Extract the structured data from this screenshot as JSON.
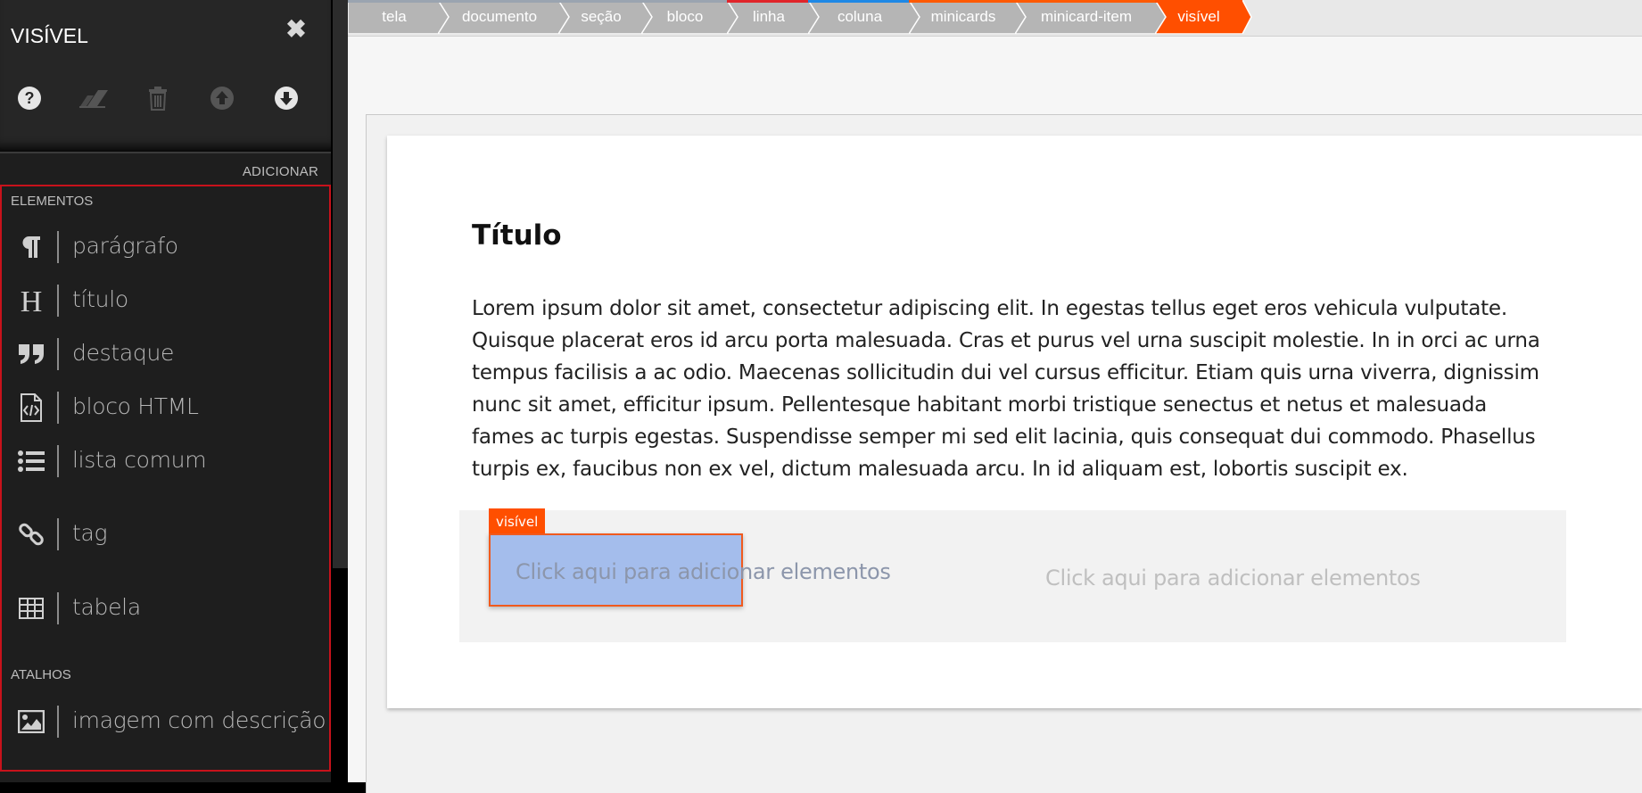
{
  "sidebar": {
    "title": "VISÍVEL",
    "close_icon": "close-icon",
    "tools": [
      {
        "name": "help-icon"
      },
      {
        "name": "eraser-icon"
      },
      {
        "name": "trash-icon"
      },
      {
        "name": "move-up-icon"
      },
      {
        "name": "move-down-icon"
      }
    ],
    "add_label": "ADICIONAR",
    "sections": {
      "elementos": "ELEMENTOS",
      "atalhos": "ATALHOS"
    },
    "elements": [
      {
        "icon": "paragraph-icon",
        "label": "parágrafo"
      },
      {
        "icon": "heading-icon",
        "label": "título"
      },
      {
        "icon": "quote-icon",
        "label": "destaque"
      },
      {
        "icon": "html-file-icon",
        "label": "bloco HTML"
      },
      {
        "icon": "list-icon",
        "label": "lista comum"
      },
      {
        "icon": "link-icon",
        "label": "tag"
      },
      {
        "icon": "table-icon",
        "label": "tabela"
      }
    ],
    "shortcuts": [
      {
        "icon": "image-icon",
        "label": "imagem com descrição"
      }
    ],
    "panel_border_color": "#c8121b"
  },
  "breadcrumbs": [
    {
      "label": "tela",
      "color": "#b5b5b5",
      "accent": "#9aa4b0"
    },
    {
      "label": "documento",
      "color": "#b5b5b5",
      "accent": "#9aa4b0"
    },
    {
      "label": "seção",
      "color": "#b5b5b5",
      "accent": "#9aa4b0"
    },
    {
      "label": "bloco",
      "color": "#b5b5b5",
      "accent": "#9aa4b0"
    },
    {
      "label": "linha",
      "color": "#b5b5b5",
      "accent": "#e0252a"
    },
    {
      "label": "coluna",
      "color": "#b5b5b5",
      "accent": "#1e88e5"
    },
    {
      "label": "minicards",
      "color": "#b5b5b5",
      "accent": "#ff5a00"
    },
    {
      "label": "minicard-item",
      "color": "#b5b5b5",
      "accent": "#ff5a00"
    },
    {
      "label": "visível",
      "color": "#ff4f00",
      "accent": "#ff4f00"
    }
  ],
  "content": {
    "title": "Título",
    "paragraph": "Lorem ipsum dolor sit amet, consectetur adipiscing elit. In egestas tellus eget eros vehicula vulputate. Quisque placerat eros id arcu porta malesuada. Cras et purus vel urna suscipit molestie. In in orci ac urna tempus facilisis a ac odio. Maecenas sollicitudin dui vel cursus efficitur. Etiam quis urna viverra, dignissim nunc sit amet, efficitur ipsum. Pellentesque habitant morbi tristique senectus et netus et malesuada fames ac turpis egestas. Suspendisse semper mi sed elit lacinia, quis consequat dui commodo. Phasellus turpis ex, faucibus non ex vel, dictum malesuada arcu. In id aliquam est, lobortis suscipit ex.",
    "selected_tag": "visível",
    "minicard_1": "Click aqui para adicionar elementos",
    "minicard_2": "Click aqui para adicionar elementos"
  },
  "colors": {
    "accent": "#ff4f00",
    "selected_fill": "#a4bdec"
  }
}
